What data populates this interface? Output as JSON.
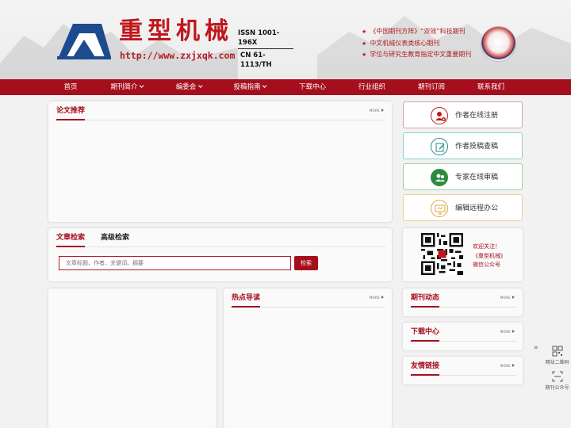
{
  "header": {
    "site_name": "重型机械",
    "url": "http://www.zxjxqk.com",
    "issn": "ISSN 1001-196X",
    "cn": "CN 61-1113/TH",
    "honors": [
      "《中国期刊方阵》“双效”科技期刊",
      "中文机械仪表类核心期刊",
      "学位与研究生教育指定中文重要期刊"
    ],
    "badge_text": "重型机械",
    "logo_icon": "book-logo-icon",
    "badge_icon": "journal-seal-icon"
  },
  "nav": {
    "items": [
      {
        "label": "首页",
        "dropdown": false
      },
      {
        "label": "期刊简介",
        "dropdown": true
      },
      {
        "label": "编委会",
        "dropdown": true
      },
      {
        "label": "投稿指南",
        "dropdown": true
      },
      {
        "label": "下载中心",
        "dropdown": false
      },
      {
        "label": "行业组织",
        "dropdown": false
      },
      {
        "label": "期刊订阅",
        "dropdown": false
      },
      {
        "label": "联系我们",
        "dropdown": false
      }
    ]
  },
  "more_label": "more",
  "paper_recommend": {
    "title": "论文推荐"
  },
  "search": {
    "tab_article": "文章检索",
    "tab_advanced": "高级检索",
    "placeholder": "文章标题、作者、关键词、摘要",
    "button": "检索"
  },
  "hot": {
    "title": "热点导读"
  },
  "side_buttons": [
    {
      "label": "作者在线注册",
      "icon": "author-register-icon",
      "color": "#c0161c"
    },
    {
      "label": "作者投稿查稿",
      "icon": "edit-submit-icon",
      "color": "#1f8a8a"
    },
    {
      "label": "专家在线审稿",
      "icon": "expert-review-icon",
      "color": "#2e8b3e"
    },
    {
      "label": "编辑远程办公",
      "icon": "monitor-office-icon",
      "color": "#e0a43a"
    }
  ],
  "wechat": {
    "lines": [
      "欢迎关注！",
      "《重型机械》",
      "微信公众号"
    ],
    "qr_icon": "qr-code-icon"
  },
  "journal_news": {
    "title": "期刊动态"
  },
  "downloads": {
    "title": "下载中心"
  },
  "links": {
    "title": "友情链接"
  },
  "float_bar": {
    "arrow": "»",
    "site_qr_label": "网站二维码",
    "journal_account_label": "期刊公众号"
  },
  "colors": {
    "brand_red": "#a50f1d",
    "accent_red": "#c0161c",
    "logo_blue": "#1c4b8f"
  }
}
